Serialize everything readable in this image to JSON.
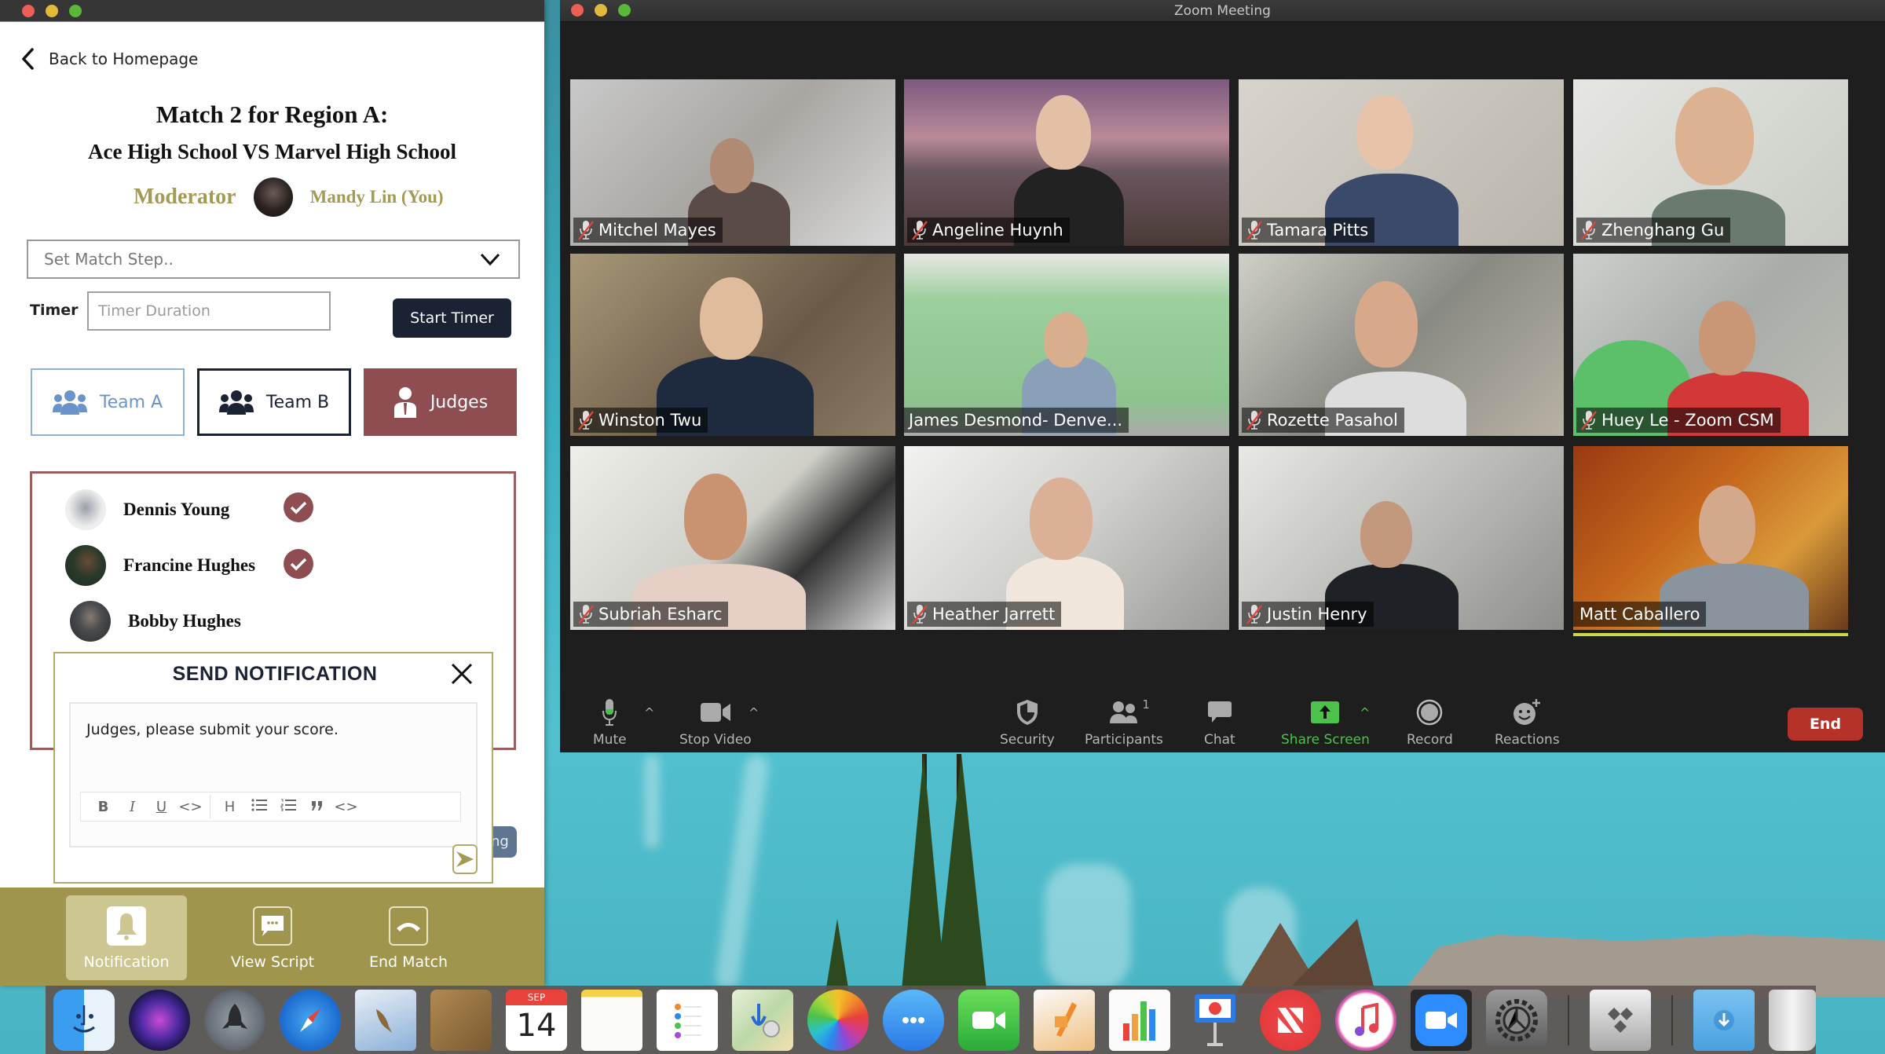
{
  "app_panel": {
    "back_label": "Back to Homepage",
    "match_title": "Match 2 for Region A:",
    "match_subtitle": "Ace High School VS Marvel High School",
    "moderator_label": "Moderator",
    "moderator_name": "Mandy Lin (You)",
    "match_step_placeholder": "Set Match Step..",
    "timer_label": "Timer",
    "timer_placeholder": "Timer Duration",
    "start_timer_label": "Start Timer",
    "tabs": [
      {
        "label": "Team A",
        "icon": "group-icon",
        "state": "outlined"
      },
      {
        "label": "Team B",
        "icon": "group-icon",
        "state": "outlined"
      },
      {
        "label": "Judges",
        "icon": "judge-icon",
        "state": "selected"
      }
    ],
    "judges": [
      {
        "name": "Dennis Young",
        "submitted": true
      },
      {
        "name": "Francine Hughes",
        "submitted": true
      },
      {
        "name": "Bobby Hughes",
        "submitted": false
      }
    ],
    "hidden_button_partial": "ng",
    "notification": {
      "title": "SEND NOTIFICATION",
      "message": "Judges, please submit your score.",
      "toolbar": [
        "B",
        "I",
        "U",
        "<>",
        "H",
        "bulleted-list",
        "numbered-list",
        "quote",
        "<>"
      ]
    },
    "bottom_nav": [
      {
        "label": "Notification",
        "icon": "bell-icon",
        "active": true
      },
      {
        "label": "View Script",
        "icon": "chat-bubble-icon",
        "active": false
      },
      {
        "label": "End Match",
        "icon": "hang-up-icon",
        "active": false
      }
    ],
    "colors": {
      "gold": "#a39a55",
      "maroon": "#8e4e51",
      "navy": "#1a2233",
      "team_a_blue": "#6a94c9",
      "bottom_bar": "#a0954c"
    }
  },
  "zoom": {
    "window_title": "Zoom Meeting",
    "participants": [
      {
        "name": "Mitchel Mayes",
        "muted": true
      },
      {
        "name": "Angeline Huynh",
        "muted": true
      },
      {
        "name": "Tamara Pitts",
        "muted": true
      },
      {
        "name": "Zhenghang Gu",
        "muted": true
      },
      {
        "name": "Winston Twu",
        "muted": true
      },
      {
        "name": "James Desmond- Denve...",
        "muted": false
      },
      {
        "name": "Rozette Pasahol",
        "muted": true
      },
      {
        "name": "Huey Le - Zoom CSM",
        "muted": true
      },
      {
        "name": "Subriah Esharc",
        "muted": true
      },
      {
        "name": "Heather Jarrett",
        "muted": true
      },
      {
        "name": "Justin Henry",
        "muted": true
      },
      {
        "name": "Matt Caballero",
        "muted": false,
        "active_speaker": true
      }
    ],
    "toolbar": {
      "mute": "Mute",
      "stop_video": "Stop Video",
      "security": "Security",
      "participants": "Participants",
      "participants_count": "1",
      "chat": "Chat",
      "share_screen": "Share Screen",
      "record": "Record",
      "reactions": "Reactions",
      "end": "End"
    },
    "colors": {
      "share_green": "#4cc24a",
      "end_red": "#b53228",
      "active_speaker": "#c7d94a"
    }
  },
  "dock": {
    "apps": [
      "Finder",
      "Siri",
      "Launchpad",
      "Safari",
      "Preview",
      "Contacts",
      "Calendar",
      "Notes",
      "Reminders",
      "Maps",
      "Photos",
      "Messages",
      "FaceTime",
      "Pages",
      "Numbers",
      "Keynote",
      "News",
      "Music",
      "Zoom",
      "System Preferences",
      "Boot Camp",
      "Downloads",
      "Trash"
    ],
    "calendar_month": "SEP",
    "calendar_day": "14"
  }
}
